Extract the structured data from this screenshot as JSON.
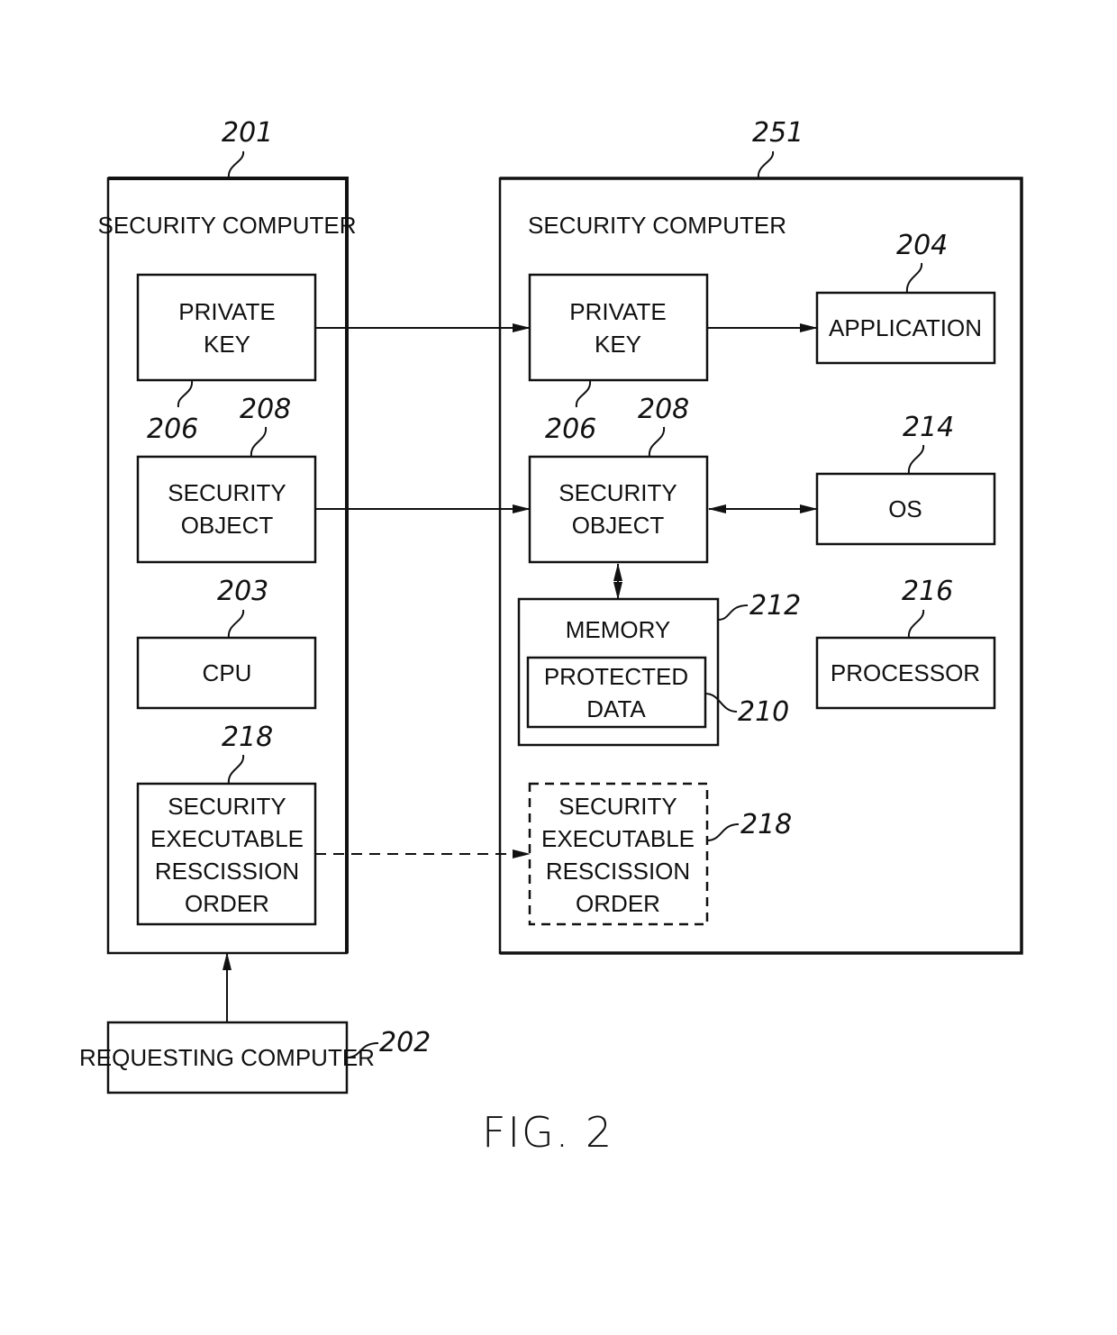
{
  "figure": {
    "caption": "FIG. 2"
  },
  "left_computer": {
    "ref": "201",
    "title": "SECURITY COMPUTER",
    "private_key": {
      "lines": [
        "PRIVATE",
        "KEY"
      ],
      "ref": "206"
    },
    "security_object": {
      "lines": [
        "SECURITY",
        "OBJECT"
      ],
      "ref": "208"
    },
    "cpu": {
      "lines": [
        "CPU"
      ],
      "ref": "203"
    },
    "rescission_order": {
      "lines": [
        "SECURITY",
        "EXECUTABLE",
        "RESCISSION",
        "ORDER"
      ],
      "ref": "218"
    }
  },
  "right_computer": {
    "ref": "251",
    "title": "SECURITY COMPUTER",
    "private_key": {
      "lines": [
        "PRIVATE",
        "KEY"
      ],
      "ref": "206"
    },
    "security_object": {
      "lines": [
        "SECURITY",
        "OBJECT"
      ],
      "ref": "208"
    },
    "application": {
      "lines": [
        "APPLICATION"
      ],
      "ref": "204"
    },
    "os": {
      "lines": [
        "OS"
      ],
      "ref": "214"
    },
    "processor": {
      "lines": [
        "PROCESSOR"
      ],
      "ref": "216"
    },
    "memory": {
      "label": "MEMORY",
      "ref": "212"
    },
    "protected_data": {
      "lines": [
        "PROTECTED",
        "DATA"
      ],
      "ref": "210"
    },
    "rescission_order": {
      "lines": [
        "SECURITY",
        "EXECUTABLE",
        "RESCISSION",
        "ORDER"
      ],
      "ref": "218"
    }
  },
  "requesting_computer": {
    "label": "REQUESTING COMPUTER",
    "ref": "202"
  }
}
